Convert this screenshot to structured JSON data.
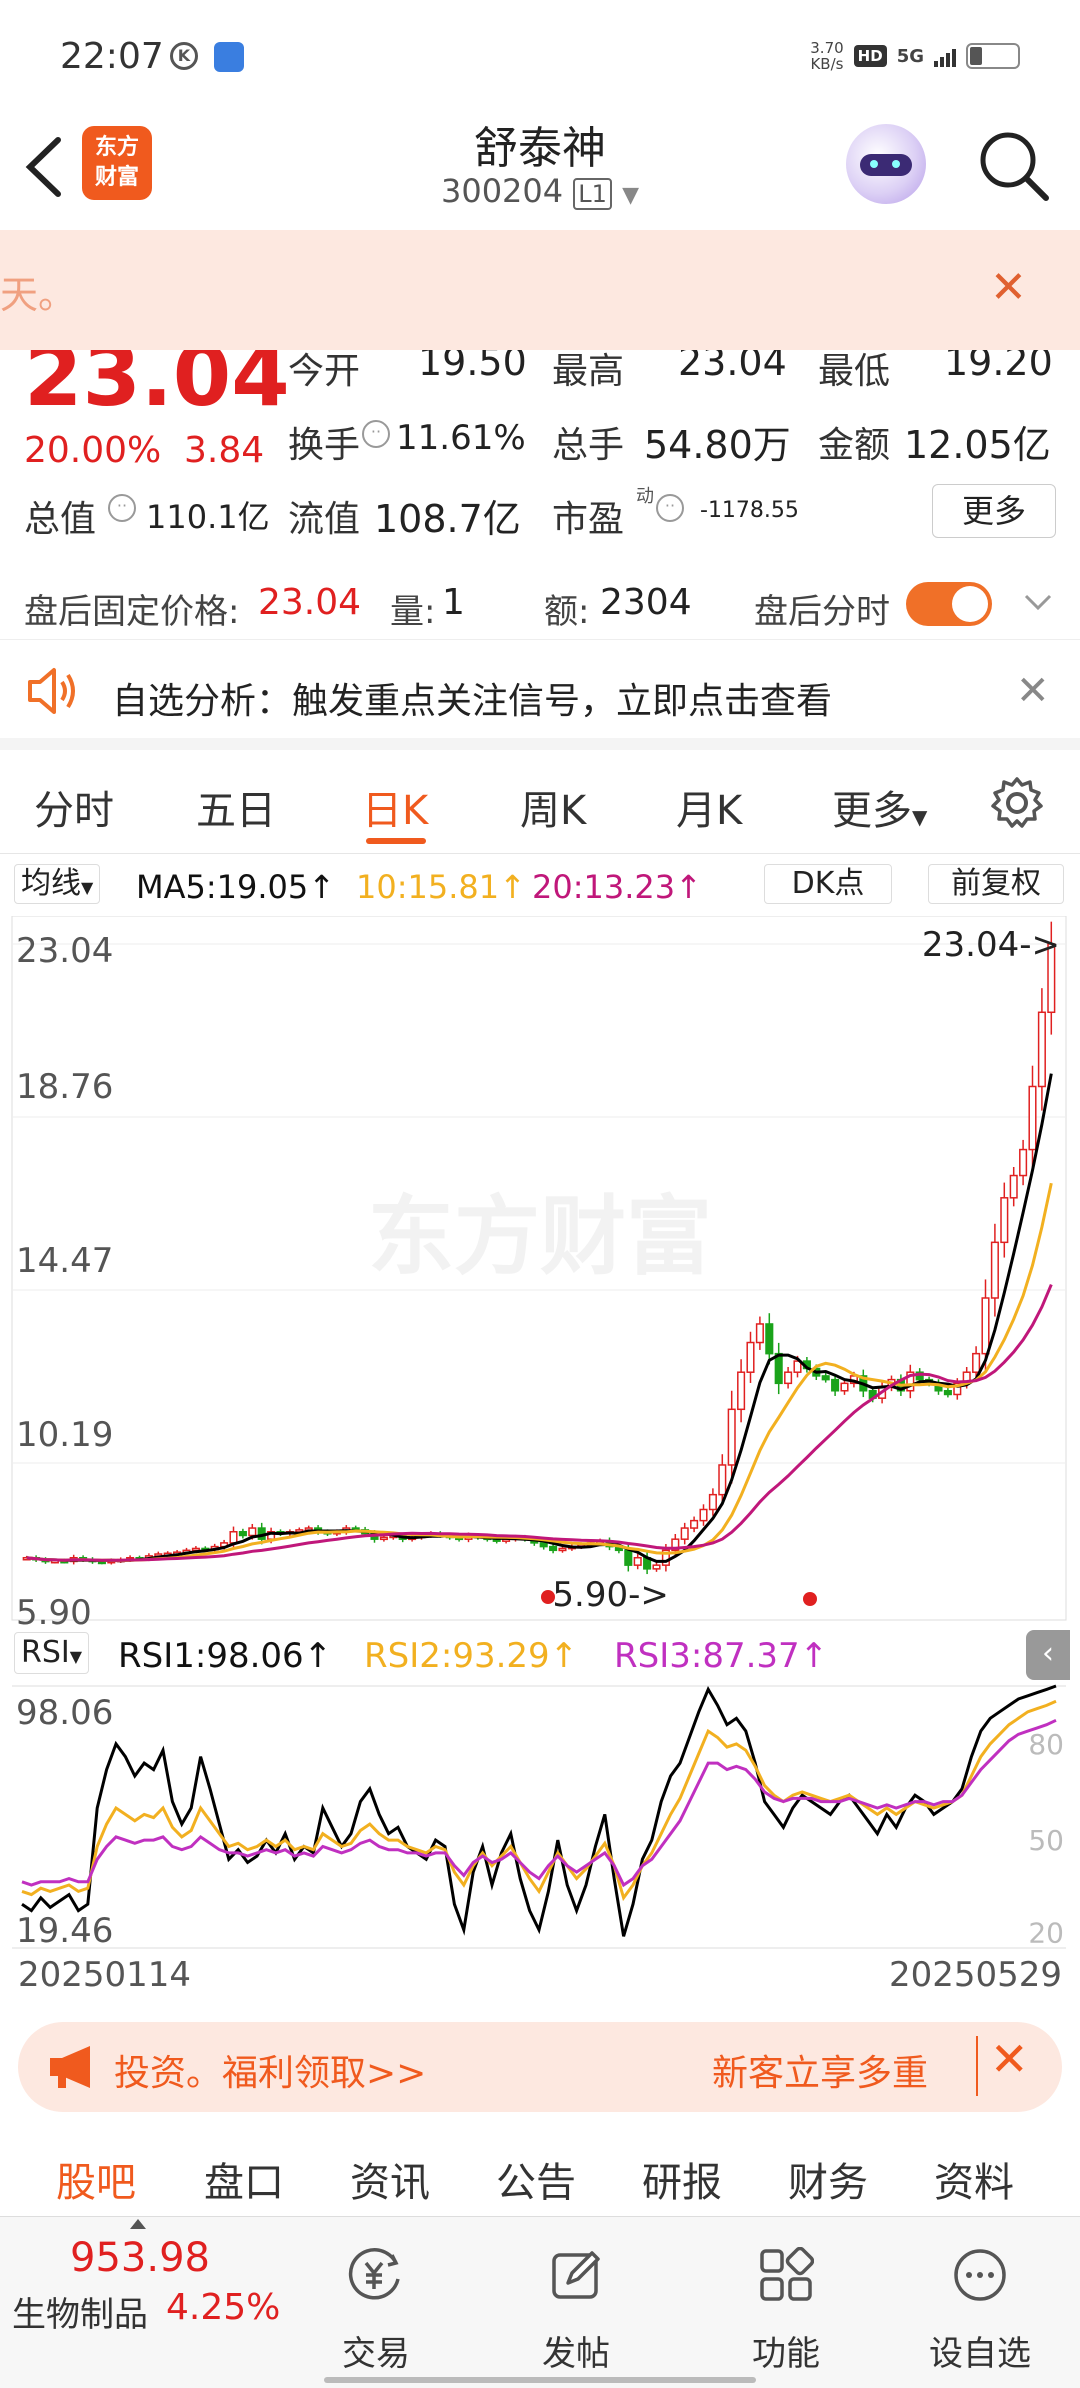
{
  "status": {
    "time": "22:07",
    "speed": "3.70",
    "speed_unit": "KB/s",
    "hd": "HD",
    "net": "5G"
  },
  "header": {
    "logo_line1": "东方",
    "logo_line2": "财富",
    "name": "舒泰神",
    "code": "300204",
    "level": "L1"
  },
  "banner": {
    "text": "天。",
    "close": "✕"
  },
  "quote": {
    "price": "23.04",
    "pct": "20.00%",
    "chg": "3.84",
    "open_label": "今开",
    "open": "19.50",
    "high_label": "最高",
    "high": "23.04",
    "low_label": "最低",
    "low": "19.20",
    "turnover_label": "换手",
    "turnover": "11.61%",
    "volume_label": "总手",
    "volume": "54.80万",
    "amount_label": "金额",
    "amount": "12.05亿",
    "mcap_label": "总值",
    "mcap": "110.1亿",
    "float_label": "流值",
    "float": "108.7亿",
    "pe_label": "市盈",
    "pe_sup": "动",
    "pe": "-1178.55",
    "more": "更多"
  },
  "after": {
    "price_label": "盘后固定价格:",
    "price": "23.04",
    "vol_label": "量:",
    "vol": "1",
    "amt_label": "额:",
    "amt": "2304",
    "toggle_label": "盘后分时"
  },
  "analysis": {
    "text": "自选分析：触发重点关注信号，立即点击查看",
    "close": "✕"
  },
  "tabs": [
    "分时",
    "五日",
    "日K",
    "周K",
    "月K",
    "更多"
  ],
  "active_tab": "日K",
  "ma": {
    "selector": "均线",
    "ma5": "MA5:19.05",
    "ma10": "10:15.81",
    "ma20": "20:13.23",
    "arrow": "↑",
    "dk": "DK点",
    "adjust": "前复权"
  },
  "rsi": {
    "selector": "RSI",
    "rsi1": "RSI1:98.06",
    "rsi2": "RSI2:93.29",
    "rsi3": "RSI3:87.37",
    "arrow": "↑"
  },
  "chart_data": [
    {
      "type": "candlestick",
      "yticks": [
        "23.04",
        "18.76",
        "14.47",
        "10.19",
        "5.90"
      ],
      "ylim": [
        5.9,
        23.04
      ],
      "max_label": "23.04->",
      "min_label": "5.90->",
      "watermark": "东方财富",
      "x_start": "20250114",
      "x_end": "20250529",
      "closes": [
        6.5,
        6.45,
        6.4,
        6.42,
        6.4,
        6.5,
        6.45,
        6.4,
        6.38,
        6.42,
        6.45,
        6.5,
        6.48,
        6.55,
        6.6,
        6.62,
        6.65,
        6.7,
        6.75,
        6.72,
        6.8,
        6.9,
        7.2,
        7.1,
        7.3,
        7.0,
        7.2,
        7.15,
        7.2,
        7.25,
        7.3,
        7.2,
        7.15,
        7.2,
        7.3,
        7.25,
        7.15,
        7.0,
        7.05,
        7.1,
        7.0,
        7.05,
        7.1,
        7.15,
        7.1,
        7.05,
        7.0,
        7.1,
        7.05,
        7.0,
        6.95,
        7.0,
        7.05,
        7.0,
        6.9,
        6.8,
        6.7,
        6.75,
        6.8,
        6.85,
        6.9,
        6.95,
        6.8,
        6.7,
        6.3,
        6.5,
        6.2,
        6.3,
        6.7,
        7.0,
        7.3,
        7.5,
        7.8,
        8.2,
        9.0,
        10.5,
        11.5,
        12.3,
        12.8,
        12.0,
        11.2,
        11.5,
        11.8,
        11.6,
        11.4,
        11.3,
        11.0,
        11.2,
        11.4,
        11.0,
        10.8,
        11.1,
        11.3,
        11.0,
        11.5,
        11.3,
        11.2,
        11.0,
        10.9,
        11.2,
        11.5,
        12.0,
        13.5,
        15.0,
        16.2,
        16.8,
        17.5,
        19.2,
        21.2,
        23.04
      ]
    },
    {
      "type": "line",
      "title": "RSI",
      "yticks": [
        "98.06",
        "19.46"
      ],
      "right_ticks": [
        "80",
        "50",
        "20"
      ],
      "series": [
        {
          "name": "RSI1",
          "values": [
            30,
            28,
            32,
            29,
            31,
            33,
            28,
            30,
            60,
            72,
            80,
            76,
            70,
            74,
            72,
            78,
            62,
            55,
            60,
            76,
            66,
            55,
            44,
            47,
            43,
            45,
            50,
            46,
            52,
            44,
            48,
            46,
            60,
            54,
            48,
            52,
            62,
            66,
            58,
            52,
            54,
            48,
            46,
            44,
            50,
            48,
            30,
            22,
            40,
            48,
            36,
            46,
            52,
            38,
            28,
            22,
            34,
            50,
            36,
            28,
            36,
            48,
            58,
            38,
            20,
            30,
            44,
            50,
            62,
            70,
            74,
            82,
            90,
            97,
            92,
            86,
            88,
            84,
            74,
            62,
            58,
            54,
            60,
            64,
            62,
            60,
            58,
            62,
            64,
            60,
            56,
            52,
            58,
            54,
            60,
            64,
            62,
            58,
            60,
            62,
            66,
            76,
            84,
            88,
            90,
            92,
            94,
            95,
            96,
            97,
            98.06
          ]
        },
        {
          "name": "RSI2",
          "values": [
            34,
            33,
            35,
            34,
            35,
            36,
            34,
            35,
            48,
            55,
            60,
            58,
            56,
            58,
            57,
            60,
            54,
            51,
            53,
            60,
            56,
            52,
            48,
            49,
            47,
            48,
            50,
            48,
            50,
            47,
            48,
            47,
            52,
            50,
            48,
            49,
            53,
            55,
            52,
            50,
            50,
            48,
            47,
            46,
            48,
            47,
            40,
            36,
            42,
            46,
            42,
            45,
            48,
            43,
            38,
            34,
            40,
            46,
            42,
            38,
            41,
            45,
            49,
            42,
            32,
            36,
            42,
            46,
            52,
            58,
            63,
            70,
            77,
            84,
            82,
            79,
            80,
            78,
            73,
            67,
            64,
            62,
            64,
            65,
            64,
            63,
            62,
            63,
            64,
            62,
            60,
            58,
            60,
            58,
            60,
            62,
            61,
            60,
            61,
            62,
            64,
            70,
            76,
            80,
            83,
            86,
            88,
            90,
            91,
            92,
            93.29
          ]
        },
        {
          "name": "RSI3",
          "values": [
            37,
            36,
            37,
            37,
            37,
            38,
            37,
            37,
            44,
            48,
            51,
            50,
            49,
            50,
            50,
            51,
            48,
            47,
            48,
            51,
            49,
            47,
            46,
            46,
            45,
            46,
            47,
            46,
            47,
            45,
            46,
            45,
            48,
            47,
            46,
            47,
            49,
            50,
            48,
            47,
            47,
            46,
            46,
            45,
            46,
            46,
            42,
            39,
            43,
            45,
            43,
            44,
            46,
            43,
            40,
            38,
            42,
            45,
            42,
            40,
            42,
            44,
            46,
            42,
            36,
            38,
            42,
            44,
            48,
            52,
            56,
            62,
            68,
            74,
            74,
            72,
            73,
            72,
            69,
            65,
            63,
            62,
            63,
            63,
            63,
            62,
            62,
            62,
            63,
            62,
            61,
            60,
            61,
            60,
            61,
            62,
            62,
            61,
            62,
            62,
            64,
            68,
            72,
            75,
            78,
            81,
            83,
            84,
            85,
            86,
            87.37
          ]
        }
      ]
    }
  ],
  "bottom_banner": {
    "left": "投资。福利领取>>",
    "right": "新客立享多重"
  },
  "bottom_tabs": [
    "股吧",
    "盘口",
    "资讯",
    "公告",
    "研报",
    "财务",
    "资料"
  ],
  "dock": {
    "index_value": "953.98",
    "index_name": "生物制品",
    "index_pct": "4.25%",
    "items": [
      "交易",
      "发帖",
      "功能",
      "设自选"
    ]
  },
  "colors": {
    "up": "#e02020",
    "down": "#1aa31a",
    "ma5": "#000000",
    "ma10": "#f2b020",
    "ma20": "#c0177a",
    "rsi3": "#c030c0",
    "accent": "#f07028"
  }
}
